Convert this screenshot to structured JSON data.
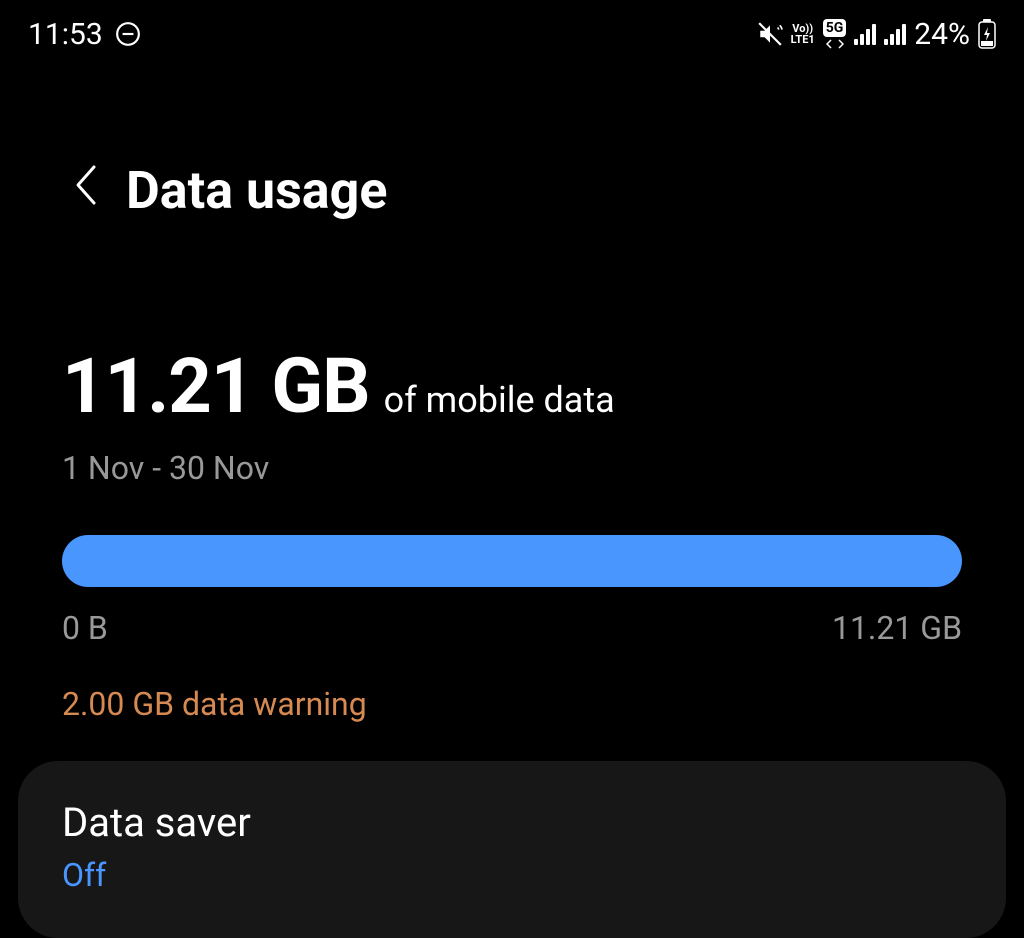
{
  "status": {
    "time": "11:53",
    "volte": "Vo))",
    "lte": "LTE1",
    "network": "5G",
    "battery": "24%"
  },
  "header": {
    "title": "Data usage"
  },
  "usage": {
    "amount": "11.21 GB",
    "label": "of mobile data",
    "date_range": "1 Nov - 30 Nov",
    "min": "0 B",
    "max": "11.21 GB",
    "warning": "2.00 GB data warning"
  },
  "data_saver": {
    "title": "Data saver",
    "status": "Off"
  }
}
